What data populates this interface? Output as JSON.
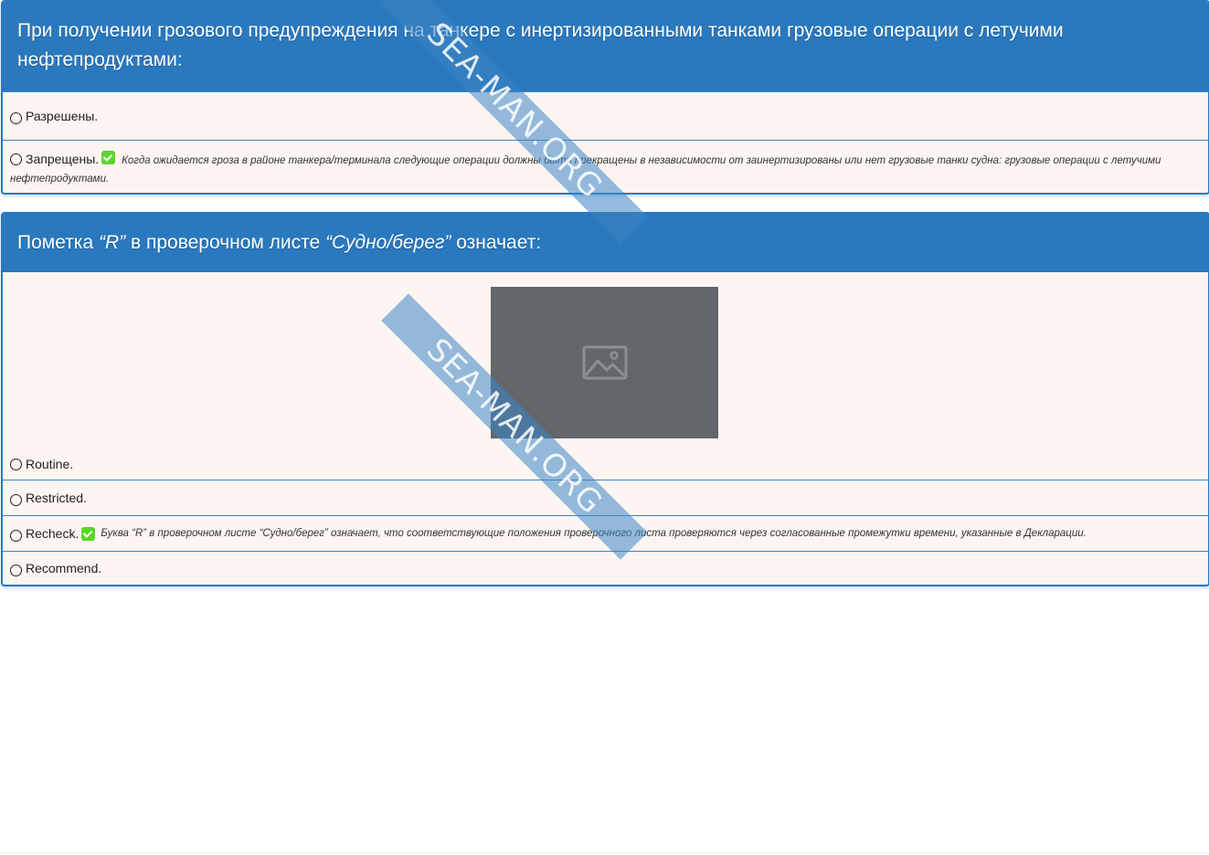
{
  "watermark": "SEA-MAN.ORG",
  "question1": {
    "text": "При получении грозового предупреждения на танкере с инертизированными танками грузовые операции с летучими нефтепродуктами:",
    "options": [
      {
        "label": "Разрешены.",
        "correct": false,
        "explanation": ""
      },
      {
        "label": "Запрещены.",
        "correct": true,
        "explanation": "Когда ожидается гроза в районе танкера/терминала следующие операции должны быть прекращены в независимости от заинертизированы или нет грузовые танки судна: грузовые операции с летучими нефтепродуктами."
      }
    ]
  },
  "question2": {
    "text_before": "Пометка ",
    "text_em1": "“R”",
    "text_mid": " в проверочном листе ",
    "text_em2": "“Судно/берег”",
    "text_after": " означает:",
    "image_icon": "image-placeholder-icon",
    "options": [
      {
        "label": "Routine.",
        "correct": false,
        "explanation": ""
      },
      {
        "label": "Restricted.",
        "correct": false,
        "explanation": ""
      },
      {
        "label": "Recheck.",
        "correct": true,
        "explanation": "Буква “R” в проверочном листе “Судно/берег” означает, что соответствующие положения проверочного листа проверяются через согласованные промежутки времени, указанные в Декларации."
      },
      {
        "label": "Recommend.",
        "correct": false,
        "explanation": ""
      }
    ]
  },
  "colors": {
    "header": "#2a78bd",
    "card_bg": "#fdf5f2",
    "check": "#5bd62a"
  }
}
